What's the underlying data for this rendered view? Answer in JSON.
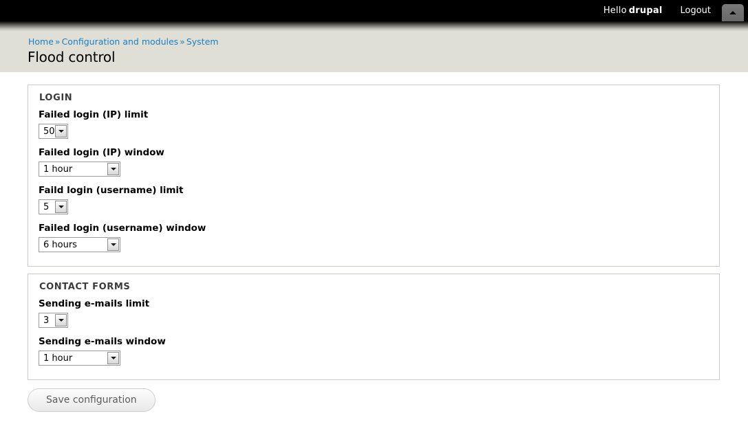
{
  "toolbar": {
    "greeting": "Hello",
    "username": "drupal",
    "logout_label": "Logout",
    "toggle_icon": "chevron-up-icon"
  },
  "breadcrumb": {
    "separator": "»",
    "items": [
      {
        "label": "Home"
      },
      {
        "label": "Configuration and modules"
      },
      {
        "label": "System"
      }
    ]
  },
  "page": {
    "title": "Flood control"
  },
  "panels": [
    {
      "legend": "LOGIN",
      "fields": [
        {
          "label": "Failed login (IP) limit",
          "value": "50",
          "size": "narrow"
        },
        {
          "label": "Failed login (IP) window",
          "value": "1 hour",
          "size": "wide"
        },
        {
          "label": "Faild login (username) limit",
          "value": "5",
          "size": "narrow"
        },
        {
          "label": "Failed login (username) window",
          "value": "6 hours",
          "size": "wide"
        }
      ]
    },
    {
      "legend": "CONTACT FORMS",
      "fields": [
        {
          "label": "Sending e-mails limit",
          "value": "3",
          "size": "narrow"
        },
        {
          "label": "Sending e-mails window",
          "value": "1 hour",
          "size": "wide"
        }
      ]
    }
  ],
  "actions": {
    "save_label": "Save configuration"
  },
  "colors": {
    "toolbar_bg": "#000000",
    "header_bg": "#dfdfd6",
    "link": "#1b7fc4",
    "panel_border": "#ccccc6",
    "content_bg": "#ffffff"
  }
}
